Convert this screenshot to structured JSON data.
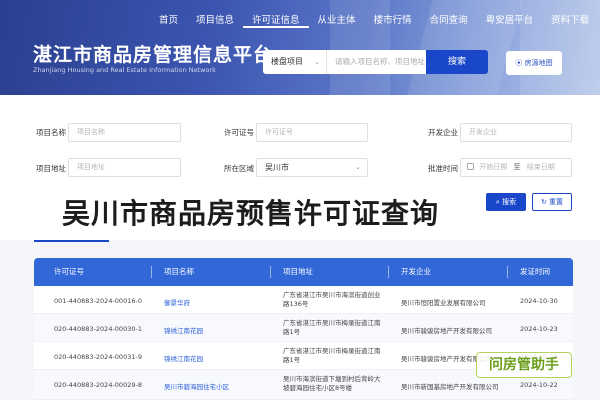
{
  "nav": [
    "首页",
    "项目信息",
    "许可证信息",
    "从业主体",
    "楼市行情",
    "合同查询",
    "粤安居平台",
    "资料下载"
  ],
  "site": {
    "title": "湛江市商品房管理信息平台",
    "subtitle": "Zhanjiang Housing and Real Estate Information Network"
  },
  "search": {
    "scope": "楼盘项目",
    "placeholder": "请输入项目名称、项目地址、开发企业",
    "button": "搜索",
    "map_button": "房源地图"
  },
  "filters": {
    "project_name_label": "项目名称",
    "project_name_placeholder": "项目名称",
    "license_label": "许可证号",
    "license_placeholder": "许可证号",
    "developer_label": "开发企业",
    "developer_placeholder": "开发企业",
    "address_label": "项目地址",
    "address_placeholder": "项目地址",
    "region_label": "所在区域",
    "region_value": "吴川市",
    "date_label": "批准时间",
    "date_start_placeholder": "开始日期",
    "date_sep": "至",
    "date_end_placeholder": "结束日期",
    "search_button": "搜索",
    "reset_button": "重置"
  },
  "overlay_title": "吴川市商品房预售许可证查询",
  "table": {
    "headers": [
      "许可证号",
      "项目名称",
      "项目地址",
      "开发企业",
      "发证时间"
    ],
    "rows": [
      {
        "license": "001-440883-2024-00016-0",
        "project": "御景华府",
        "address": "广东省湛江市吴川市海滨街道创业路136号",
        "developer": "吴川市恒阳置业发展有限公司",
        "date": "2024-10-30"
      },
      {
        "license": "020-440883-2024-00030-1",
        "project": "锦绣江南花园",
        "address": "广东省湛江市吴川市梅录街道江南路1号",
        "developer": "吴川市骏骏房地产开发有限公司",
        "date": "2024-10-23"
      },
      {
        "license": "020-440883-2024-00031-9",
        "project": "锦绣江南花园",
        "address": "广东省湛江市吴川市梅录街道江南路1号",
        "developer": "吴川市骏骏房地产开发有限公司",
        "date": "2024-10-22"
      },
      {
        "license": "020-440883-2024-00029-8",
        "project": "吴川市碧海园住宅小区",
        "address": "吴川市海滨街道下塘到村后背岭大坡碧海园住宅小区8号楼",
        "developer": "吴川市新国基房地产开发有限公司",
        "date": "2024-10-22"
      }
    ]
  },
  "watermark": "问房管助手"
}
